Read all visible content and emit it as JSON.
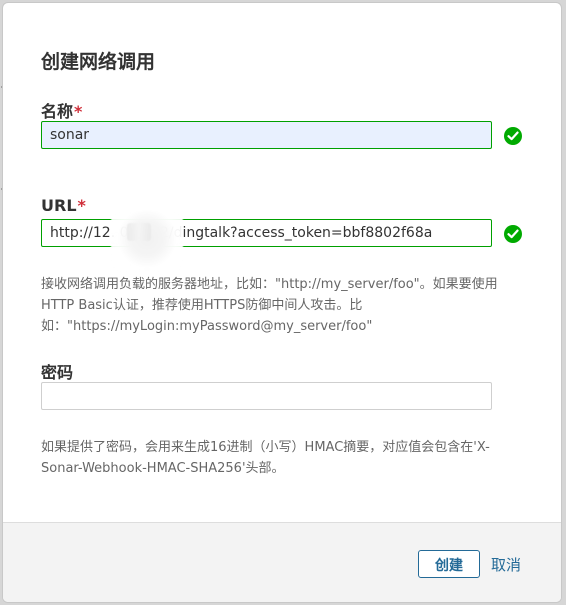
{
  "dialog": {
    "title": "创建网络调用",
    "name_field": {
      "label": "名称",
      "required": "*",
      "value": "sonar"
    },
    "url_field": {
      "label": "URL",
      "required": "*",
      "value": "http://12.       0:9002/dingtalk?access_token=bbf8802f68a"
    },
    "url_help": "接收网络调用负载的服务器地址，比如：\"http://my_server/foo\"。如果要使用HTTP Basic认证，推荐使用HTTPS防御中间人攻击。比如：\"https://myLogin:myPassword@my_server/foo\"",
    "secret_field": {
      "label": "密码",
      "value": ""
    },
    "secret_help": "如果提供了密码，会用来生成16进制（小写）HMAC摘要，对应值会包含在'X-Sonar-Webhook-HMAC-SHA256'头部。",
    "buttons": {
      "create": "创建",
      "cancel": "取消"
    },
    "icons": {
      "name_valid": "check-circle-icon",
      "url_valid": "check-circle-icon"
    },
    "colors": {
      "primary": "#236a97",
      "valid": "#00aa00",
      "required": "#d02f3a",
      "text": "#333333",
      "help_text": "#666666"
    }
  }
}
